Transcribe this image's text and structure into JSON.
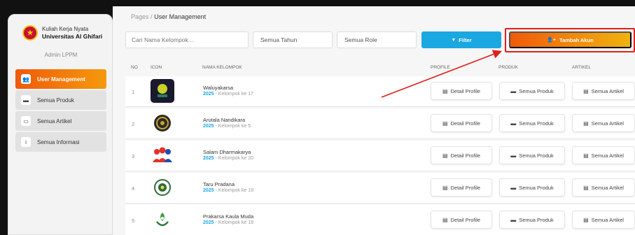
{
  "sidebar": {
    "brand": {
      "line1": "Kuliah Kerja Nyata",
      "line2": "Universitas Al Ghifari",
      "logo_icon": "university-seal-icon"
    },
    "admin_label": "Admin LPPM",
    "items": [
      {
        "label": "User Management",
        "icon": "users-icon",
        "glyph": "👥",
        "active": true
      },
      {
        "label": "Semua Produk",
        "icon": "box-icon",
        "glyph": "▬"
      },
      {
        "label": "Semua Artikel",
        "icon": "article-icon",
        "glyph": "▭"
      },
      {
        "label": "Semua Informasi",
        "icon": "info-icon",
        "glyph": "i"
      }
    ]
  },
  "breadcrumb": {
    "root": "Pages",
    "separator": "/",
    "current": "User Management"
  },
  "toolbar": {
    "search_placeholder": "Cari Nama Kelompok...",
    "year_select": "Semua Tahun",
    "role_select": "Semua Role",
    "filter_label": "Filter",
    "filter_icon": "▼",
    "add_label": "Tambah Akun",
    "add_icon": "👤+"
  },
  "table": {
    "headers": {
      "no": "NO",
      "icon": "ICON",
      "name": "NAMA KELOMPOK",
      "profile": "PROFILE",
      "produk": "PRODUK",
      "artikel": "ARTIKEL"
    },
    "action_labels": {
      "profile": "Detail Profile",
      "produk": "Semua Produk",
      "artikel": "Semua Artikel"
    },
    "rows": [
      {
        "no": "1",
        "name": "Waluyakarsa",
        "year": "2025",
        "group": " - Kelompok ke 17"
      },
      {
        "no": "2",
        "name": "Arutala Nandikara",
        "year": "2025",
        "group": " - Kelompok ke 5"
      },
      {
        "no": "3",
        "name": "Salam Dharmakarya",
        "year": "2025",
        "group": " - Kelompok ke 20"
      },
      {
        "no": "4",
        "name": "Taru Pradana",
        "year": "2025",
        "group": " - Kelompok ke 19"
      },
      {
        "no": "5",
        "name": "Prakarsa Kaula Muda",
        "year": "2025",
        "group": " - Kelompok ke 18"
      }
    ]
  },
  "colors": {
    "accent_orange": "#f05a0a",
    "accent_blue": "#1ba8e0",
    "highlight_red": "#e0201b"
  }
}
